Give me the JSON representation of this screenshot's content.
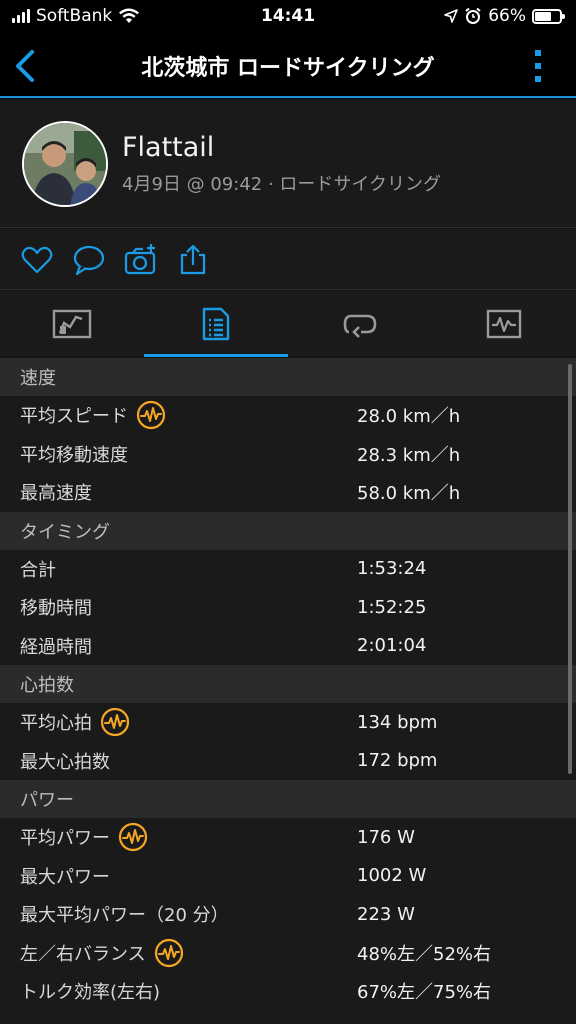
{
  "status_bar": {
    "carrier": "SoftBank",
    "time": "14:41",
    "battery_pct": "66%",
    "battery_level": 0.66
  },
  "nav": {
    "title": "北茨城市 ロードサイクリング"
  },
  "profile": {
    "name": "Flattail",
    "meta": "4月9日 @ 09:42 · ロードサイクリング"
  },
  "tabs": [
    "overview-tab",
    "stats-tab",
    "laps-tab",
    "charts-tab"
  ],
  "colors": {
    "accent": "#1a9be6",
    "badge": "#f5a623"
  },
  "sections": [
    {
      "title": "速度",
      "rows": [
        {
          "label": "平均スピード",
          "value": "28.0 km／h",
          "badge": true
        },
        {
          "label": "平均移動速度",
          "value": "28.3 km／h",
          "badge": false
        },
        {
          "label": "最高速度",
          "value": "58.0 km／h",
          "badge": false
        }
      ]
    },
    {
      "title": "タイミング",
      "rows": [
        {
          "label": "合計",
          "value": "1:53:24",
          "badge": false
        },
        {
          "label": "移動時間",
          "value": "1:52:25",
          "badge": false
        },
        {
          "label": "経過時間",
          "value": "2:01:04",
          "badge": false
        }
      ]
    },
    {
      "title": "心拍数",
      "rows": [
        {
          "label": "平均心拍",
          "value": "134 bpm",
          "badge": true
        },
        {
          "label": "最大心拍数",
          "value": "172 bpm",
          "badge": false
        }
      ]
    },
    {
      "title": "パワー",
      "rows": [
        {
          "label": "平均パワー",
          "value": "176 W",
          "badge": true
        },
        {
          "label": "最大パワー",
          "value": "1002 W",
          "badge": false
        },
        {
          "label": "最大平均パワー（20 分）",
          "value": "223 W",
          "badge": false
        },
        {
          "label": "左／右バランス",
          "value": "48%左／52%右",
          "badge": true
        },
        {
          "label": "トルク効率(左右)",
          "value": "67%左／75%右",
          "badge": false
        }
      ]
    }
  ]
}
